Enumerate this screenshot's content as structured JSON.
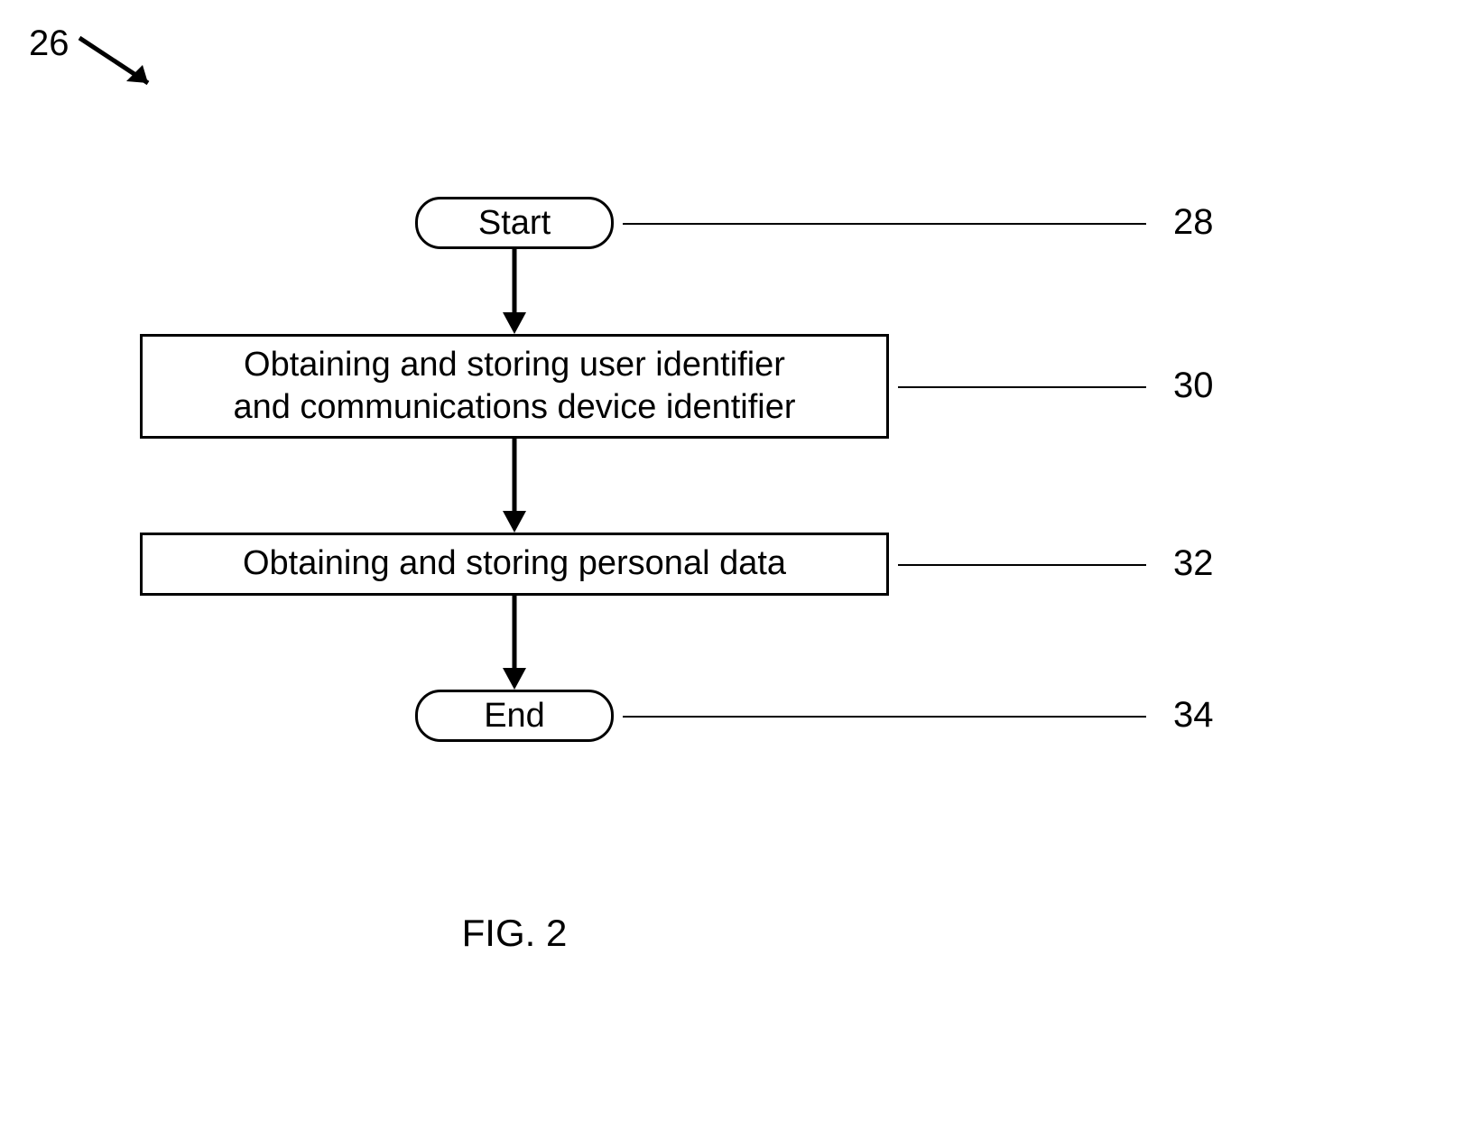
{
  "diagram_ref": "26",
  "nodes": {
    "start": {
      "label": "Start",
      "ref": "28"
    },
    "step1": {
      "label": "Obtaining and storing user identifier\nand communications device identifier",
      "ref": "30"
    },
    "step2": {
      "label": "Obtaining and storing personal data",
      "ref": "32"
    },
    "end": {
      "label": "End",
      "ref": "34"
    }
  },
  "caption": "FIG. 2"
}
